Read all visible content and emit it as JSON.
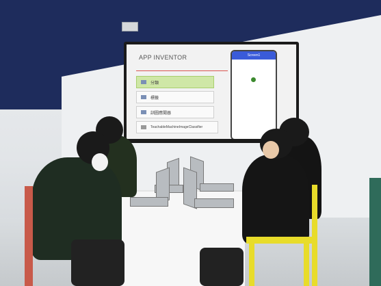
{
  "screen": {
    "title": "APP INVENTOR",
    "menu": [
      {
        "label": "分類",
        "active": true
      },
      {
        "label": "標籤",
        "active": false
      },
      {
        "label": "訓圖應聞器",
        "active": false
      },
      {
        "label": "TeachableMachineImageClassifier",
        "active": false
      }
    ],
    "phone_header": "Screen1"
  },
  "colors": {
    "wall_blue": "#1e2c5c",
    "chair_yellow": "#e8dc2a",
    "chair_red": "#c85a4a",
    "active_menu": "#cfe7a6"
  }
}
